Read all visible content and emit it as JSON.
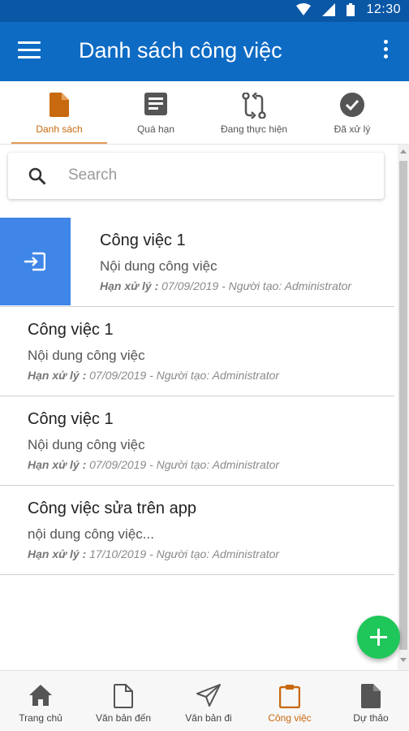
{
  "status_bar": {
    "time": "12:30",
    "wifi_icon": "wifi-icon",
    "signal_icon": "signal-icon",
    "battery_icon": "battery-icon"
  },
  "app_bar": {
    "title": "Danh sách công việc",
    "menu_icon": "hamburger-menu-icon",
    "more_icon": "more-vert-icon",
    "color": "#0e6bc4"
  },
  "tabs": [
    {
      "label": "Danh sách",
      "icon": "document-icon",
      "active": true
    },
    {
      "label": "Quá hạn",
      "icon": "notes-icon",
      "active": false
    },
    {
      "label": "Đang thực hiện",
      "icon": "swap-arrows-icon",
      "active": false
    },
    {
      "label": "Đã xử lý",
      "icon": "check-circle-icon",
      "active": false
    }
  ],
  "search": {
    "placeholder": "Search",
    "icon": "search-icon"
  },
  "tasks": [
    {
      "title": "Công việc 1",
      "content": "Nội dung công việc",
      "deadline_label": "Hạn xử lý :",
      "rest": " 07/09/2019 - Người tạo: Administrator",
      "swipe_action_icon": "enter-icon"
    },
    {
      "title": "Công việc 1",
      "content": "Nội dung công việc",
      "deadline_label": "Hạn xử lý :",
      "rest": " 07/09/2019 - Người tạo: Administrator"
    },
    {
      "title": "Công việc 1",
      "content": "Nội dung công việc",
      "deadline_label": "Hạn xử lý :",
      "rest": " 07/09/2019 - Người tạo: Administrator"
    },
    {
      "title": "Công việc sửa trên app",
      "content": "nội dung công việc...",
      "deadline_label": "Hạn xử lý :",
      "rest": " 17/10/2019 - Người tạo: Administrator"
    }
  ],
  "fab": {
    "icon": "plus-icon",
    "color": "#1fc65a"
  },
  "bottom_nav": [
    {
      "label": "Trang chủ",
      "icon": "home-icon",
      "active": false
    },
    {
      "label": "Văn bản đến",
      "icon": "file-icon",
      "active": false
    },
    {
      "label": "Văn bản đi",
      "icon": "send-icon",
      "active": false
    },
    {
      "label": "Công việc",
      "icon": "clipboard-icon",
      "active": true
    },
    {
      "label": "Dự thảo",
      "icon": "draft-icon",
      "active": false
    }
  ],
  "colors": {
    "accent": "#c8690f",
    "swipe_action": "#3f86e8"
  }
}
